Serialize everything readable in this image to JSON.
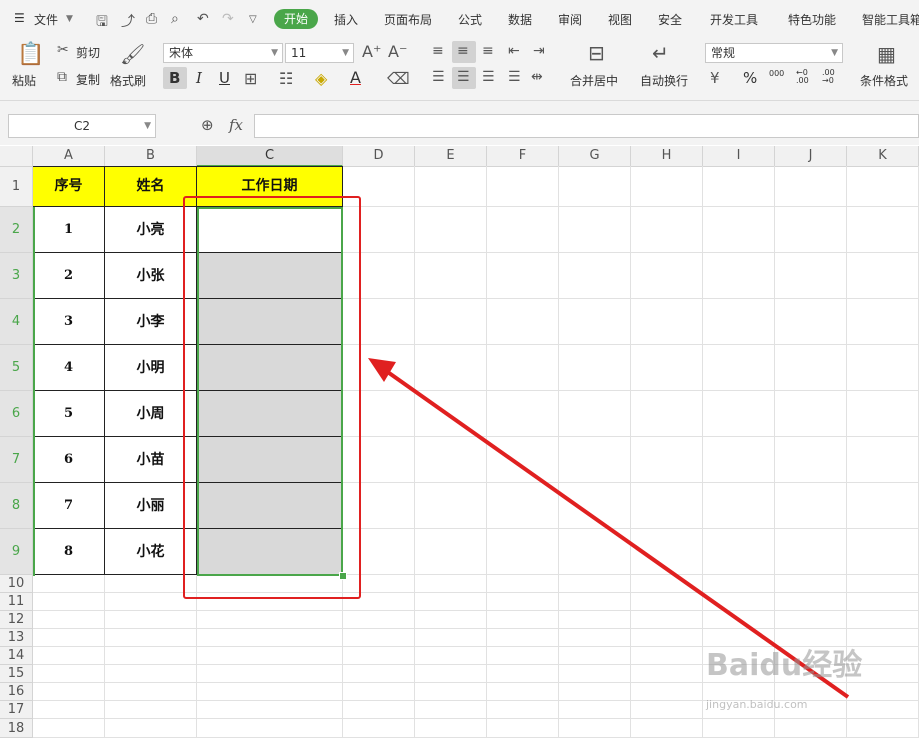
{
  "menubar": {
    "file_label": "文件",
    "tabs": [
      "开始",
      "插入",
      "页面布局",
      "公式",
      "数据",
      "审阅",
      "视图",
      "安全",
      "开发工具",
      "特色功能",
      "智能工具箱"
    ],
    "active_tab": "开始"
  },
  "ribbon": {
    "paste_label": "粘贴",
    "cut_label": "剪切",
    "copy_label": "复制",
    "format_painter_label": "格式刷",
    "font_name": "宋体",
    "font_size": "11",
    "bold_glyph": "B",
    "italic_glyph": "I",
    "underline_glyph": "U",
    "merge_center_label": "合并居中",
    "wrap_text_label": "自动换行",
    "number_format": "常规",
    "conditional_format_label": "条件格式",
    "percent_glyph": "%",
    "thousands_glyph": "000",
    "increase_decimal_glyph": "←0 .00",
    "decrease_decimal_glyph": ".00 →0"
  },
  "formula_bar": {
    "name_box": "C2",
    "fx_label": "fx",
    "value": ""
  },
  "sheet": {
    "columns": [
      "A",
      "B",
      "C",
      "D",
      "E",
      "F",
      "G",
      "H",
      "I",
      "J",
      "K"
    ],
    "selected_column": "C",
    "rows": [
      "1",
      "2",
      "3",
      "4",
      "5",
      "6",
      "7",
      "8",
      "9",
      "10",
      "11",
      "12",
      "13",
      "14",
      "15",
      "16",
      "17",
      "18"
    ],
    "table_header": [
      "序号",
      "姓名",
      "工作日期"
    ],
    "table_rows": [
      [
        "1",
        "小亮",
        ""
      ],
      [
        "2",
        "小张",
        ""
      ],
      [
        "3",
        "小李",
        ""
      ],
      [
        "4",
        "小明",
        ""
      ],
      [
        "5",
        "小周",
        ""
      ],
      [
        "6",
        "小苗",
        ""
      ],
      [
        "7",
        "小丽",
        ""
      ],
      [
        "8",
        "小花",
        ""
      ]
    ]
  },
  "watermark": {
    "text": "Baidu经验",
    "url_text": "jingyan.baidu.com"
  },
  "colors": {
    "accent_green": "#4aa64a",
    "header_yellow": "#ffff00",
    "selection_gray": "#d9d9d9",
    "annotation_red": "#e02020"
  }
}
